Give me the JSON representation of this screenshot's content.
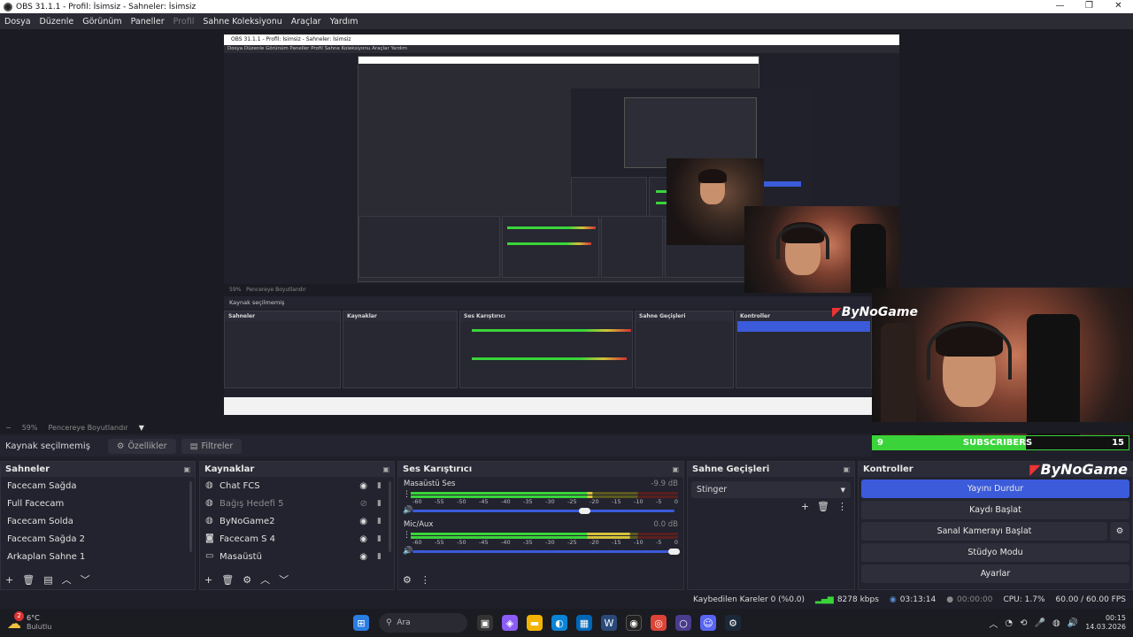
{
  "titlebar": {
    "title": "OBS 31.1.1 - Profil: İsimsiz - Sahneler: İsimsiz",
    "minimize": "—",
    "maximize": "❐",
    "close": "✕"
  },
  "menu": [
    "Dosya",
    "Düzenle",
    "Görünüm",
    "Paneller",
    "Profil",
    "Sahne Koleksiyonu",
    "Araçlar",
    "Yardım"
  ],
  "nested": {
    "title": "OBS 31.1.1 - Profil: İsimsiz - Sahneler: İsimsiz",
    "menu": "Dosya   Düzenle   Görünüm   Paneller   Profil   Sahne Koleksiyonu   Araçlar   Yardım",
    "zoom": "59%",
    "fit": "Pencereye Boyutlandır",
    "no_source": "Kaynak seçilmemiş",
    "scenes_title": "Sahneler",
    "sources_title": "Kaynaklar",
    "mixer_title": "Ses Karıştırıcı",
    "trans_title": "Sahne Geçişleri",
    "ctrl_title": "Kontroller"
  },
  "overlay": {
    "subs_count": "9",
    "subs_label": "SUBSCRIBERS",
    "subs_goal": "15",
    "logo": "ByNoGame",
    "subs_progress": 0.6
  },
  "zoombar": {
    "minus": "−",
    "zoom": "59%",
    "fit": "Pencereye Boyutlandır",
    "caret": "▼"
  },
  "sourcebar": {
    "no_selection": "Kaynak seçilmemiş",
    "properties": "Özellikler",
    "filters": "Filtreler"
  },
  "scenes": {
    "title": "Sahneler",
    "items": [
      "Facecam Sağda",
      "Full Facecam",
      "Facecam Solda",
      "Facecam Sağda 2",
      "Arkaplan Sahne 1"
    ]
  },
  "sources": {
    "title": "Kaynaklar",
    "items": [
      {
        "name": "Chat FCS",
        "icon": "globe-icon"
      },
      {
        "name": "Bağış Hedefi 5",
        "icon": "globe-icon"
      },
      {
        "name": "ByNoGame2",
        "icon": "globe-icon"
      },
      {
        "name": "Facecam S 4",
        "icon": "camera-icon"
      },
      {
        "name": "Masaüstü",
        "icon": "monitor-icon"
      }
    ]
  },
  "mixer": {
    "title": "Ses Karıştırıcı",
    "ticks": [
      "-60",
      "-55",
      "-50",
      "-45",
      "-40",
      "-35",
      "-30",
      "-25",
      "-20",
      "-15",
      "-10",
      "-5",
      "0"
    ],
    "channels": [
      {
        "name": "Masaüstü Ses",
        "db": "-9.9 dB",
        "level": 0.68,
        "volume": 0.66
      },
      {
        "name": "Mic/Aux",
        "db": "0.0 dB",
        "level": 0.82,
        "volume": 1.0
      }
    ]
  },
  "transitions": {
    "title": "Sahne Geçişleri",
    "selected": "Stinger"
  },
  "controls": {
    "title": "Kontroller",
    "logo": "ByNoGame",
    "buttons": [
      "Yayını Durdur",
      "Kaydı Başlat",
      "Sanal Kamerayı Başlat",
      "Stüdyo Modu",
      "Ayarlar"
    ]
  },
  "status": {
    "dropped": "Kaybedilen Kareler 0 (%0.0)",
    "bitrate": "8278 kbps",
    "stream_time": "03:13:14",
    "rec_time": "00:00:00",
    "cpu": "CPU: 1.7%",
    "fps": "60.00 / 60.00 FPS"
  },
  "taskbar": {
    "weather_temp": "6°C",
    "weather_desc": "Bulutlu",
    "badge": "2",
    "search": "Ara",
    "time": "00:15",
    "date": "14.03.2026"
  }
}
